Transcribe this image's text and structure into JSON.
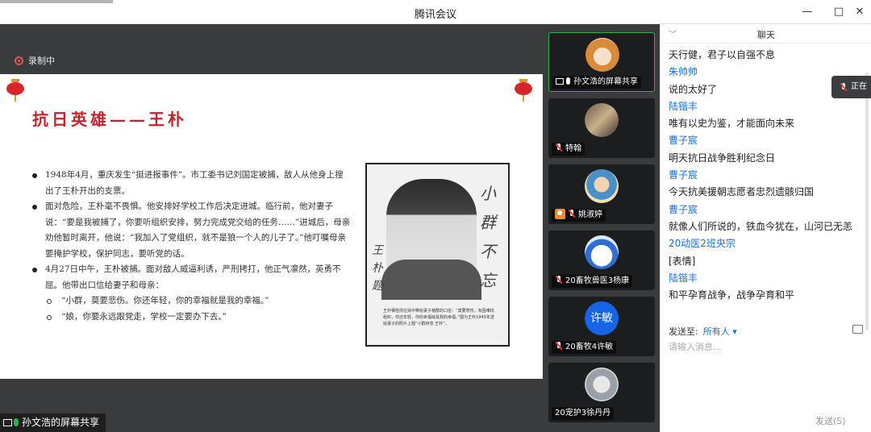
{
  "window": {
    "title": "腾讯会议",
    "minimize": "—",
    "maximize": "□",
    "close": "✕"
  },
  "recording": {
    "label": "录制中"
  },
  "slide": {
    "title": "抗日英雄——王朴",
    "bullets": [
      {
        "level": 1,
        "text": "1948年4月，重庆发生“挺进报事件”。市工委书记刘国定被捕，敌人从他身上搜出了王朴开出的支票。"
      },
      {
        "level": 1,
        "text": "面对危险，王朴毫不畏惧。他安排好学校工作后决定进城。临行前，他对妻子说：“要是我被捕了，你要听组织安排，努力完成党交给的任务……”进城后，母亲劝他暂时离开，他说：“我加入了党组织，就不是狼一个人的儿子了。”他叮嘱母亲要掩护学校，保护同志，要听党的话。"
      },
      {
        "level": 1,
        "text": "4月27日中午，王朴被捕。面对敌人威逼利诱，严刑拷打，他正气凛然，英勇不屈。他带出口信给妻子和母亲："
      },
      {
        "level": 2,
        "text": "“小群，莫要悲伤。你还年轻，你的幸福就是我的幸福。”"
      },
      {
        "level": 2,
        "text": "“娘，你要永远跟党走，学校一定要办下去。”"
      }
    ],
    "photo_signature": "小群不忘",
    "photo_signature_left": "王朴题",
    "photo_caption": "王朴牺牲前在狱中带给妻子褚群的口信：“莫要悲伤，有困难找组织，你还年轻，你的幸福就是我的幸福。”图为王朴1945年送给妻子的照片上题“小群存念 王朴”。"
  },
  "sharer": {
    "label": "孙文浩的屏幕共享"
  },
  "participants": [
    {
      "name": "孙文浩的屏幕共享",
      "avatar": "dog-avatar",
      "icon": "screen-share"
    },
    {
      "name": "特翰",
      "avatar": "street-avatar",
      "icon": "mic-muted"
    },
    {
      "name": "姚淑婷",
      "avatar": "girl-avatar",
      "icon": "mic-muted"
    },
    {
      "name": "20畜牧兽医3杨康",
      "avatar": "cartoon-avatar",
      "icon": "mic-muted"
    },
    {
      "name": "20畜牧4许敏",
      "avatar_text": "许敏",
      "icon": "mic-muted"
    },
    {
      "name": "20宠护3徐丹丹",
      "avatar": "anime-avatar",
      "icon": "none"
    }
  ],
  "chat": {
    "title": "聊天",
    "messages": [
      {
        "sender": "",
        "text": "天行健，君子以自强不息"
      },
      {
        "sender": "朱帅帅",
        "text": "说的太好了"
      },
      {
        "sender": "陆锴丰",
        "text": "唯有以史为鉴，才能面向未来"
      },
      {
        "sender": "曹子宸",
        "text": "明天抗日战争胜利纪念日"
      },
      {
        "sender": "曹子宸",
        "text": "今天抗美援朝志愿者忠烈遗骸归国"
      },
      {
        "sender": "曹子宸",
        "text": "就像人们所说的，铁血今犹在，山河已无恙"
      },
      {
        "sender": "20动医2班央宗",
        "text": "[表情]"
      },
      {
        "sender": "陆锴丰",
        "text": "和平孕育战争，战争孕育和平"
      }
    ],
    "send_to_label": "发送至:",
    "recipient": "所有人",
    "input_placeholder": "请输入消息...",
    "send_button": "发送(S)"
  },
  "floating_speaker": {
    "label": "正在"
  },
  "colors": {
    "accent_blue": "#1b6fe0",
    "slide_title_red": "#c8232c",
    "active_tile_green": "#2bb24c",
    "recording_red": "#e25454"
  }
}
